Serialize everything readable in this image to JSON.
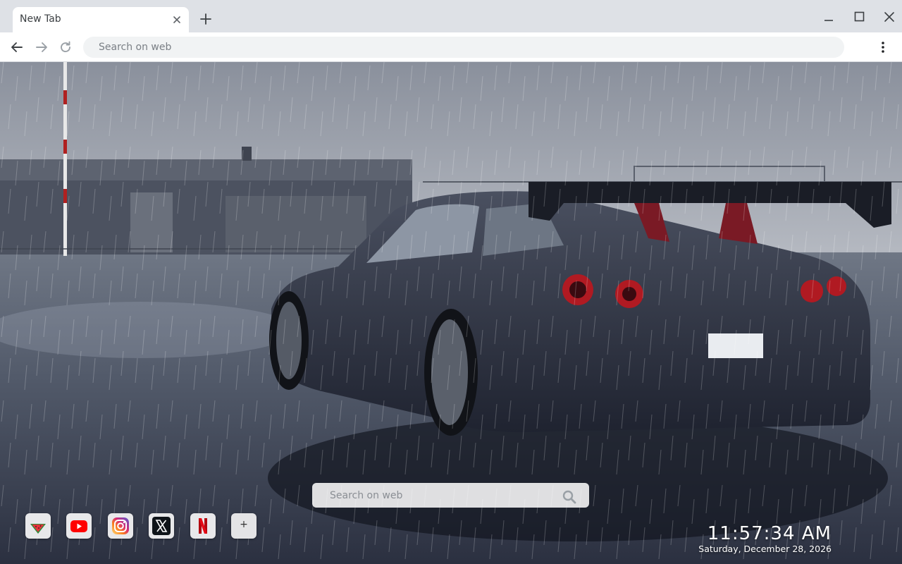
{
  "browser": {
    "tab": {
      "title": "New Tab"
    },
    "omnibox": {
      "placeholder": "Search on web",
      "value": ""
    }
  },
  "page": {
    "wallpaper": {
      "description_icon": "car-wallpaper-image"
    },
    "search": {
      "placeholder": "Search on web",
      "value": ""
    },
    "shortcuts": [
      {
        "name": "Watermelon",
        "icon": "watermelon-icon"
      },
      {
        "name": "YouTube",
        "icon": "youtube-icon"
      },
      {
        "name": "Instagram",
        "icon": "instagram-icon"
      },
      {
        "name": "X",
        "icon": "x-icon"
      },
      {
        "name": "Netflix",
        "icon": "netflix-icon"
      }
    ],
    "add_shortcut_label": "+",
    "clock": {
      "time": "11:57:34 AM",
      "date": "Saturday, December 28, 2026"
    }
  },
  "colors": {
    "tabstrip": "#dee1e6",
    "toolbar": "#ffffff",
    "omnibox": "#f1f3f4",
    "youtube_red": "#ff0000",
    "netflix_red": "#e50914"
  }
}
